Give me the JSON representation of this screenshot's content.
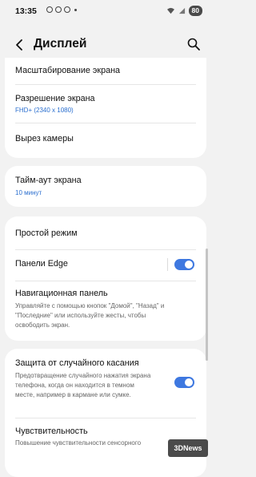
{
  "status_bar": {
    "time": "13:35",
    "battery": "80",
    "notification_icons": [
      "notification-icon",
      "notification-icon",
      "notification-icon"
    ]
  },
  "header": {
    "title": "Дисплей",
    "back_icon": "chevron-left-icon",
    "search_icon": "search-icon"
  },
  "items": {
    "screen_scale": {
      "title": "Масштабирование экрана"
    },
    "resolution": {
      "title": "Разрешение экрана",
      "value": "FHD+ (2340 x 1080)"
    },
    "camera_cutout": {
      "title": "Вырез камеры"
    },
    "timeout": {
      "title": "Тайм-аут экрана",
      "value": "10 минут"
    },
    "simple_mode": {
      "title": "Простой режим"
    },
    "edge_panels": {
      "title": "Панели Edge",
      "enabled": true
    },
    "navigation_bar": {
      "title": "Навигационная панель",
      "description": "Управляйте с помощью кнопок \"Домой\", \"Назад\" и \"Последние\" или используйте жесты, чтобы освободить экран."
    },
    "accidental_touch": {
      "title": "Защита от случайного касания",
      "description": "Предотвращение случайного нажатия экрана телефона, когда он находится в темном месте, например в кармане или сумке.",
      "enabled": true
    },
    "sensitivity": {
      "title": "Чувствительность",
      "description": "Повышение чувствительности сенсорного"
    }
  },
  "colors": {
    "accent": "#3e78e0",
    "link": "#2b6fcf",
    "background": "#f2f2f2",
    "card": "#ffffff"
  }
}
